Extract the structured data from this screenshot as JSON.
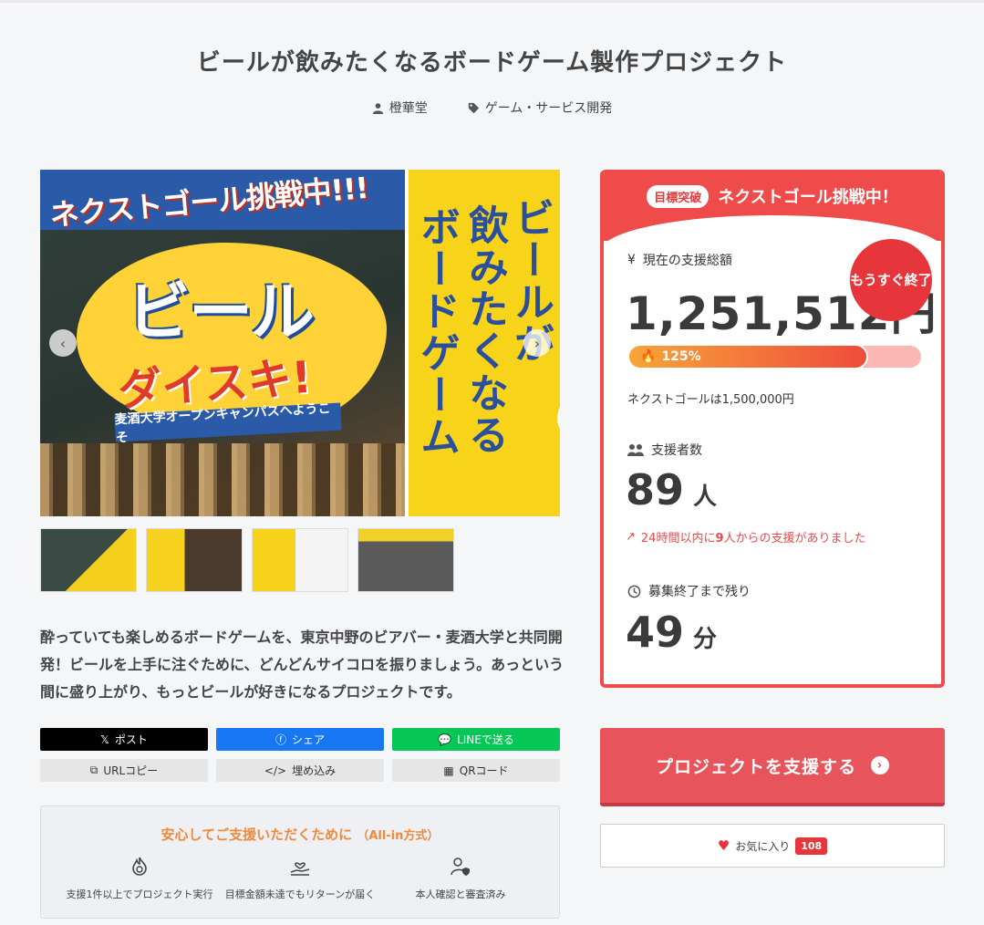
{
  "project": {
    "title": "ビールが飲みたくなるボードゲーム製作プロジェクト",
    "owner": "橙華堂",
    "category": "ゲーム・サービス開発",
    "description": "酔っていても楽しめるボードゲームを、東京中野のビアバー・麦酒大学と共同開発！ビールを上手に注ぐために、どんどんサイコロを振りましょう。あっという間に盛り上がり、もっとビールが好きになるプロジェクトです。"
  },
  "hero": {
    "ribbon": "ネクストゴール挑戦中!!!",
    "beer_word": "ビール",
    "daisuki": "ダイスキ!",
    "banner": "麦酒大学オープンキャンパスへようこそ",
    "vertical_col1": "ビールが",
    "vertical_col2": "飲みたくなる",
    "vertical_col3": "ボードゲーム",
    "prev_icon": "chevron-left-icon",
    "next_icon": "chevron-right-icon"
  },
  "share": {
    "x": "ポスト",
    "facebook": "シェア",
    "line": "LINEで送る",
    "url_copy": "URLコピー",
    "embed": "埋め込み",
    "qr": "QRコード"
  },
  "safety": {
    "heading": "安心してご支援いただくために",
    "heading_small": "（All-in方式）",
    "items": [
      {
        "label": "支援1件以上でプロジェクト実行",
        "icon": "flame-check-icon"
      },
      {
        "label": "目標金額未達でもリターンが届く",
        "icon": "hand-heart-icon"
      },
      {
        "label": "本人確認と審査済み",
        "icon": "user-shield-icon"
      }
    ]
  },
  "status": {
    "goal_badge": "目標突破",
    "head_text": "ネクストゴール挑戦中！",
    "amount_label": "現在の支援総額",
    "amount": "1,251,512円",
    "ending_soon": "もうすぐ終了",
    "progress_text": "125%",
    "progress_fraction": 0.82,
    "next_goal": "ネクストゴールは1,500,000円",
    "backers_label": "支援者数",
    "backers": "89",
    "backers_unit": "人",
    "recent_prefix": "24時間以内に",
    "recent_count": "9",
    "recent_suffix": "人からの支援がありました",
    "remaining_label": "募集終了まで残り",
    "remaining": "49",
    "remaining_unit": "分"
  },
  "actions": {
    "support": "プロジェクトを支援する",
    "favorite": "お気に入り",
    "favorite_count": "108"
  },
  "colors": {
    "accent_red": "#ef4b4b",
    "support_button": "#e8545c",
    "safety_heading": "#f08a3a"
  }
}
